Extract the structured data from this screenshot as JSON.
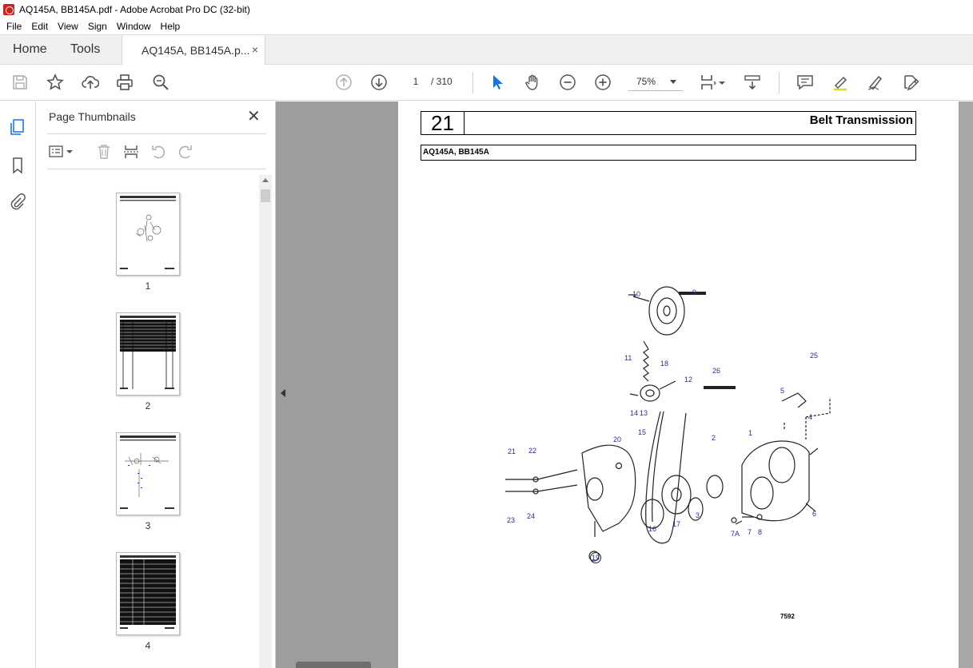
{
  "window": {
    "title": "AQ145A, BB145A.pdf - Adobe Acrobat Pro DC (32-bit)"
  },
  "menu": [
    "File",
    "Edit",
    "View",
    "Sign",
    "Window",
    "Help"
  ],
  "tabs": {
    "home": "Home",
    "tools": "Tools",
    "document": "AQ145A, BB145A.p...",
    "close": "×"
  },
  "toolbar": {
    "page_current": "1",
    "page_total": "/ 310",
    "zoom": "75%"
  },
  "panel": {
    "title": "Page Thumbnails",
    "close": "✕",
    "thumbnails": [
      {
        "label": "1"
      },
      {
        "label": "2"
      },
      {
        "label": "3"
      },
      {
        "label": "4"
      }
    ]
  },
  "page": {
    "section_number": "21",
    "section_title": "Belt Transmission",
    "models": "AQ145A, BB145A",
    "figure_number": "7592",
    "callouts": [
      "10",
      "9",
      "18",
      "11",
      "12",
      "26",
      "25",
      "5",
      "14",
      "13",
      "4",
      "15",
      "1",
      "2",
      "20",
      "21",
      "22",
      "23",
      "24",
      "19",
      "16",
      "17",
      "3",
      "7A",
      "7",
      "8",
      "6"
    ]
  },
  "colors": {
    "accent": "#2a2aa8",
    "brand": "#d4201c"
  }
}
